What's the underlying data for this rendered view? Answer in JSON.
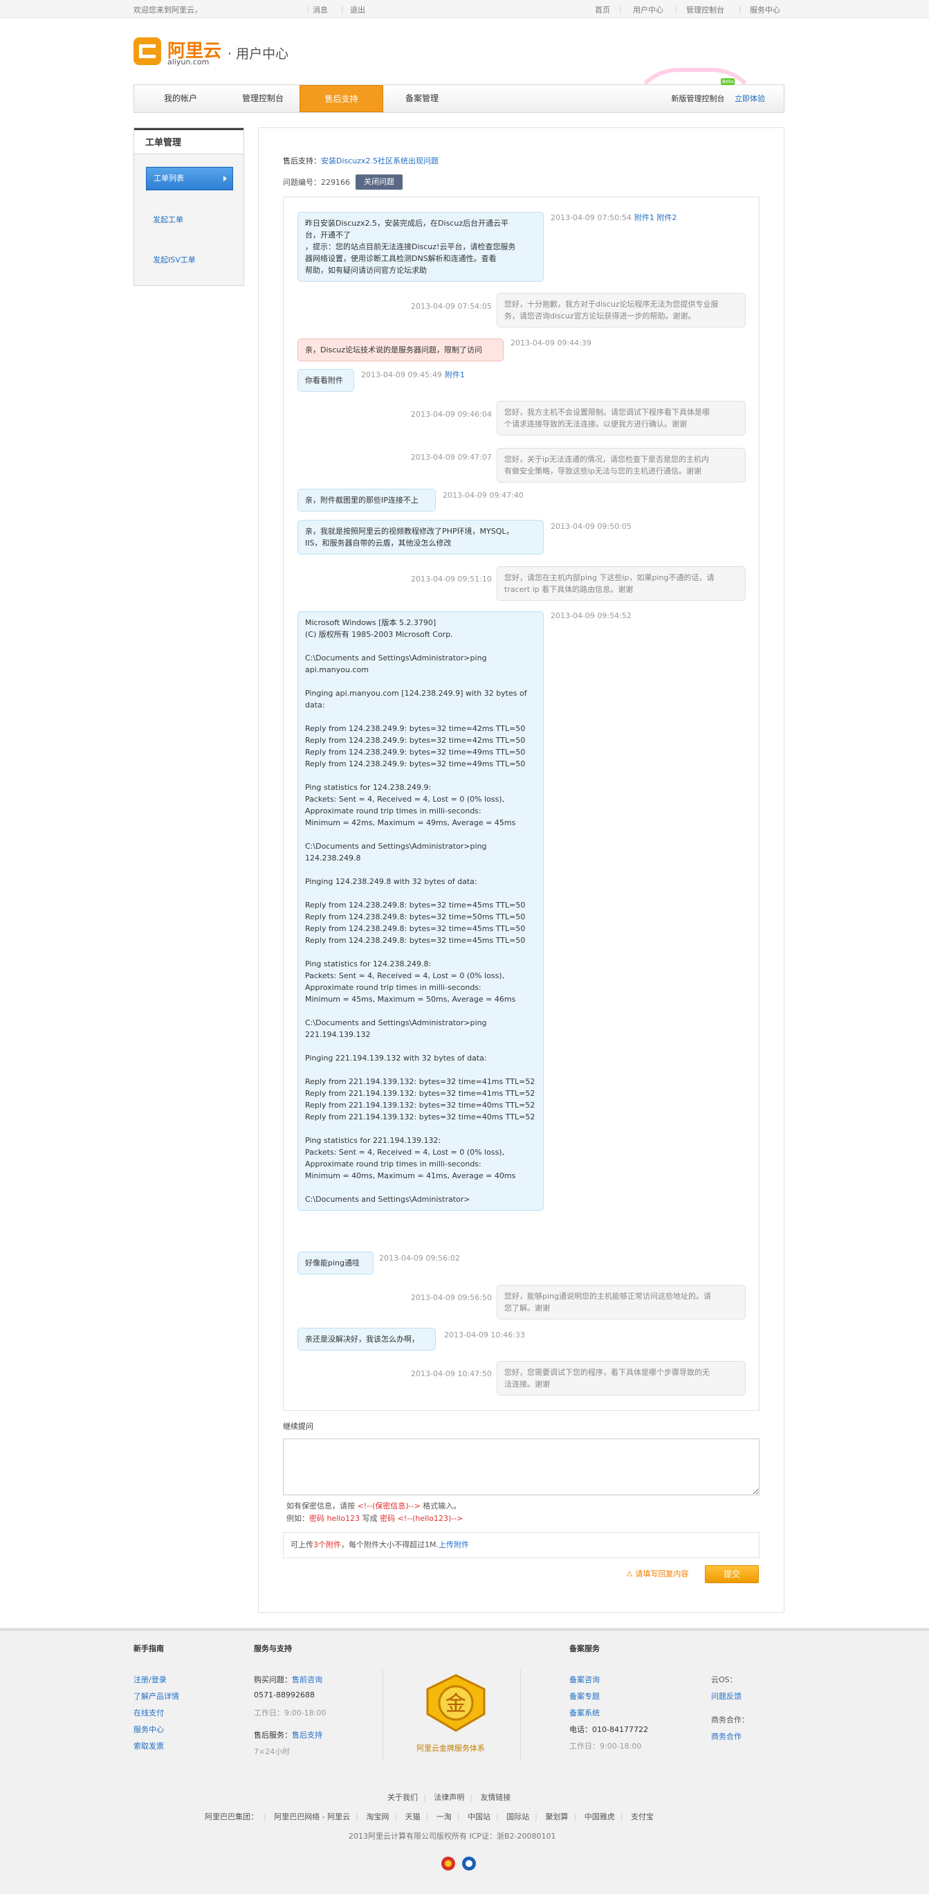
{
  "topbar": {
    "welcome": "欢迎您来到阿里云，",
    "msg": "消息",
    "logout": "退出",
    "home": "首页",
    "user_center": "用户中心",
    "console": "管理控制台",
    "service": "服务中心"
  },
  "logo": {
    "cn": "阿里云",
    "en": "aliyun.com",
    "sub": "· 用户中心"
  },
  "nav": {
    "items": [
      "我的帐户",
      "管理控制台",
      "售后支持",
      "备案管理"
    ],
    "new_console": "新版管理控制台",
    "try_now": "立即体验",
    "beta": "Beta"
  },
  "sidebar": {
    "title": "工单管理",
    "active": "工单列表",
    "links": [
      "发起工单",
      "发起ISV工单"
    ]
  },
  "ticket": {
    "prefix": "售后支持：",
    "title": "安装Discuzx2.5社区系统出现问题",
    "no_label": "问题编号：229166",
    "close": "关闭问题"
  },
  "messages": [
    {
      "role": "u",
      "text": "昨日安装Discuzx2.5，安装完成后，在Discuz后台开通云平\n台，开通不了\n，提示：您的站点目前无法连接Discuz!云平台，请检查您服务\n器网络设置，使用诊断工具检测DNS解析和连通性。查看\n帮助，如有疑问请访问官方论坛求助",
      "time": "2013-04-09 07:50:54",
      "att": "附件1 附件2"
    },
    {
      "role": "s",
      "text": "您好，十分抱歉，我方对于discuz论坛程序无法为您提供专业服\n务，请您咨询discuz官方论坛获得进一步的帮助。谢谢。",
      "time": "2013-04-09 07:54:05"
    },
    {
      "role": "r",
      "text": "亲，Discuz论坛技术说的是服务器问题，限制了访问",
      "time": "2013-04-09 09:44:39"
    },
    {
      "role": "u",
      "text": "你看看附件",
      "time": "2013-04-09 09:45:49",
      "att": "附件1"
    },
    {
      "role": "s",
      "text": "您好，我方主机不会设置限制。请您调试下程序看下具体是哪\n个请求连接导致的无法连接。以便我方进行确认。谢谢",
      "time": "2013-04-09 09:46:04"
    },
    {
      "role": "s",
      "text": "您好，关于ip无法连通的情况，请您检查下是否是您的主机内\n有做安全策略，导致这些ip无法与您的主机进行通信。谢谢",
      "time": "2013-04-09 09:47:07"
    },
    {
      "role": "u",
      "text": "亲，附件截图里的那些IP连接不上",
      "time": "2013-04-09 09:47:40"
    },
    {
      "role": "u",
      "text": "亲，我就是按照阿里云的视频教程修改了PHP环境，MYSQL，\nIIS，和服务器自带的云盾，其他没怎么修改",
      "time": "2013-04-09 09:50:05"
    },
    {
      "role": "s",
      "text": "您好，请您在主机内部ping 下这些ip，如果ping不通的话，请\ntracert ip 看下具体的路由信息。谢谢",
      "time": "2013-04-09 09:51:10"
    },
    {
      "role": "u",
      "text": "Microsoft Windows [版本 5.2.3790]\n(C) 版权所有 1985-2003 Microsoft Corp.\n\nC:\\Documents and Settings\\Administrator>ping\napi.manyou.com\n\nPinging api.manyou.com [124.238.249.9] with 32 bytes of\ndata:\n\nReply from 124.238.249.9: bytes=32 time=42ms TTL=50\nReply from 124.238.249.9: bytes=32 time=42ms TTL=50\nReply from 124.238.249.9: bytes=32 time=49ms TTL=50\nReply from 124.238.249.9: bytes=32 time=49ms TTL=50\n\nPing statistics for 124.238.249.9:\nPackets: Sent = 4, Received = 4, Lost = 0 (0% loss),\nApproximate round trip times in milli-seconds:\nMinimum = 42ms, Maximum = 49ms, Average = 45ms\n\nC:\\Documents and Settings\\Administrator>ping\n124.238.249.8\n\nPinging 124.238.249.8 with 32 bytes of data:\n\nReply from 124.238.249.8: bytes=32 time=45ms TTL=50\nReply from 124.238.249.8: bytes=32 time=50ms TTL=50\nReply from 124.238.249.8: bytes=32 time=45ms TTL=50\nReply from 124.238.249.8: bytes=32 time=45ms TTL=50\n\nPing statistics for 124.238.249.8:\nPackets: Sent = 4, Received = 4, Lost = 0 (0% loss),\nApproximate round trip times in milli-seconds:\nMinimum = 45ms, Maximum = 50ms, Average = 46ms\n\nC:\\Documents and Settings\\Administrator>ping\n221.194.139.132\n\nPinging 221.194.139.132 with 32 bytes of data:\n\nReply from 221.194.139.132: bytes=32 time=41ms TTL=52\nReply from 221.194.139.132: bytes=32 time=41ms TTL=52\nReply from 221.194.139.132: bytes=32 time=40ms TTL=52\nReply from 221.194.139.132: bytes=32 time=40ms TTL=52\n\nPing statistics for 221.194.139.132:\nPackets: Sent = 4, Received = 4, Lost = 0 (0% loss),\nApproximate round trip times in milli-seconds:\nMinimum = 40ms, Maximum = 41ms, Average = 40ms\n\nC:\\Documents and Settings\\Administrator>",
      "time": "2013-04-09 09:54:52"
    },
    {
      "role": "u",
      "text": "好像能ping通哇",
      "time": "2013-04-09 09:56:02"
    },
    {
      "role": "s",
      "text": "您好，能够ping通说明您的主机能够正常访问这些地址的。请\n您了解。谢谢",
      "time": "2013-04-09 09:56:50"
    },
    {
      "role": "u",
      "text": "亲还是没解决好，我该怎么办啊，",
      "time": "2013-04-09 10:46:33"
    },
    {
      "role": "s",
      "text": "您好，您需要调试下您的程序，看下具体是哪个步骤导致的无\n法连接。谢谢",
      "time": "2013-04-09 10:47:50"
    }
  ],
  "reply": {
    "label": "继续提问",
    "hint1_pre": "如有保密信息，请按 ",
    "hint1_tag": "<!--(保密信息)-->",
    "hint1_post": " 格式输入。",
    "hint2_pre": "例如：",
    "hint2_a": "密码 hello123",
    "hint2_mid": " 写成 ",
    "hint2_b": "密码 <!--(hello123)-->",
    "attach_pre": "可上传",
    "attach_count": "3个附件",
    "attach_mid": "，每个附件大小不得超过1M.",
    "attach_link": "上传附件",
    "warn": "请填写回复内容",
    "submit": "提交"
  },
  "footer": {
    "col1_title": "新手指南",
    "col1_links": [
      "注册/登录",
      "了解产品详情",
      "在线支付",
      "服务中心",
      "索取发票"
    ],
    "col2_title": "服务与支持",
    "pre_label": "购买问题：",
    "pre_link": "售前咨询",
    "pre_phone": "0571-88992688",
    "pre_hours": "工作日：9:00-18:00",
    "after_label": "售后服务：",
    "after_link": "售后支持",
    "after_hours": "7×24小时",
    "medal_text": "阿里云金牌服务体系",
    "col3_title": "备案服务",
    "col3_links": [
      "备案咨询",
      "备案专题",
      "备案系统"
    ],
    "col3_phone": "电话：010-84177722",
    "col3_hours": "工作日：9:00-18:00",
    "os_label": "云OS：",
    "os_link": "问题反馈",
    "biz_label": "商务合作：",
    "biz_link": "商务合作",
    "bottom_links": [
      "关于我们",
      "法律声明",
      "友情链接"
    ],
    "group_label": "阿里巴巴集团：",
    "group_links": [
      "阿里巴巴网络 - 阿里云",
      "淘宝网",
      "天猫",
      "一淘",
      "中国站",
      "国际站",
      "聚划算",
      "中国雅虎",
      "支付宝"
    ],
    "copyright": "2013阿里云计算有限公司版权所有 ICP证：浙B2-20080101"
  }
}
